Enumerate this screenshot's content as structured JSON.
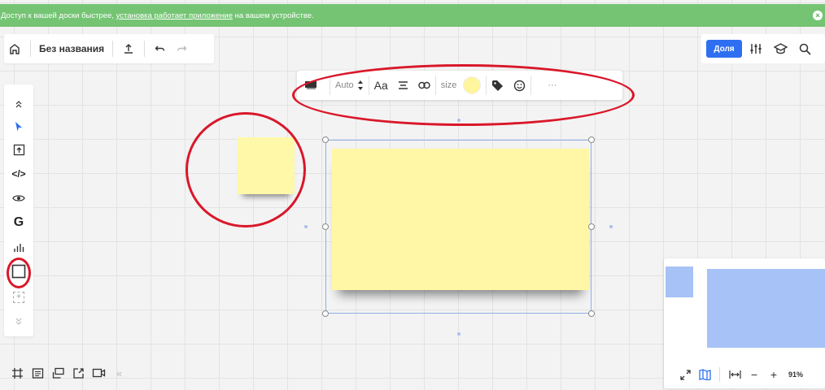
{
  "banner": {
    "text_before": "Доступ к вашей доски быстрее,",
    "link_text": "установка работает приложение",
    "text_after": "на вашем устройстве.",
    "close": "×",
    "color": "#74c474"
  },
  "topbar": {
    "title": "Без названия",
    "icons": [
      "home-icon",
      "upload-icon",
      "undo-icon",
      "redo-icon"
    ]
  },
  "topright": {
    "share_label": "Доля",
    "accent": "#2d6ff0",
    "icons": [
      "settings-sliders-icon",
      "learning-cap-icon",
      "search-icon"
    ]
  },
  "leftbar": {
    "icons": [
      "collapse-up-icon",
      "select-cursor-icon",
      "upload-frame-icon",
      "embed-code-icon",
      "eye-icon",
      "google-icon",
      "chart-icon",
      "square-shape-icon",
      "add-more-icon",
      "expand-down-icon"
    ],
    "plus": "+",
    "code": "</>",
    "google": "G"
  },
  "context_toolbar": {
    "auto_label": "Auto",
    "font_label": "Aa",
    "size_label": "size",
    "more_label": "···",
    "sticky_color": "#fff59d",
    "icons": [
      "sticky-shadow-icon",
      "stepper-icon",
      "align-icon",
      "link-icon",
      "tag-icon",
      "emoji-icon"
    ]
  },
  "canvas": {
    "sticky_color": "#fff7a6",
    "selection_color": "#8eb0e6",
    "annotation_color": "#d9172a"
  },
  "bottombar": {
    "icons": [
      "frames-icon",
      "comments-icon",
      "cards-icon",
      "share-screen-icon",
      "video-icon",
      "collapse-left-icon"
    ],
    "collapse": "«"
  },
  "minimap": {
    "zoom": "91%",
    "minus": "−",
    "plus": "+",
    "icons": [
      "fullscreen-icon",
      "map-icon",
      "fit-width-icon"
    ]
  }
}
